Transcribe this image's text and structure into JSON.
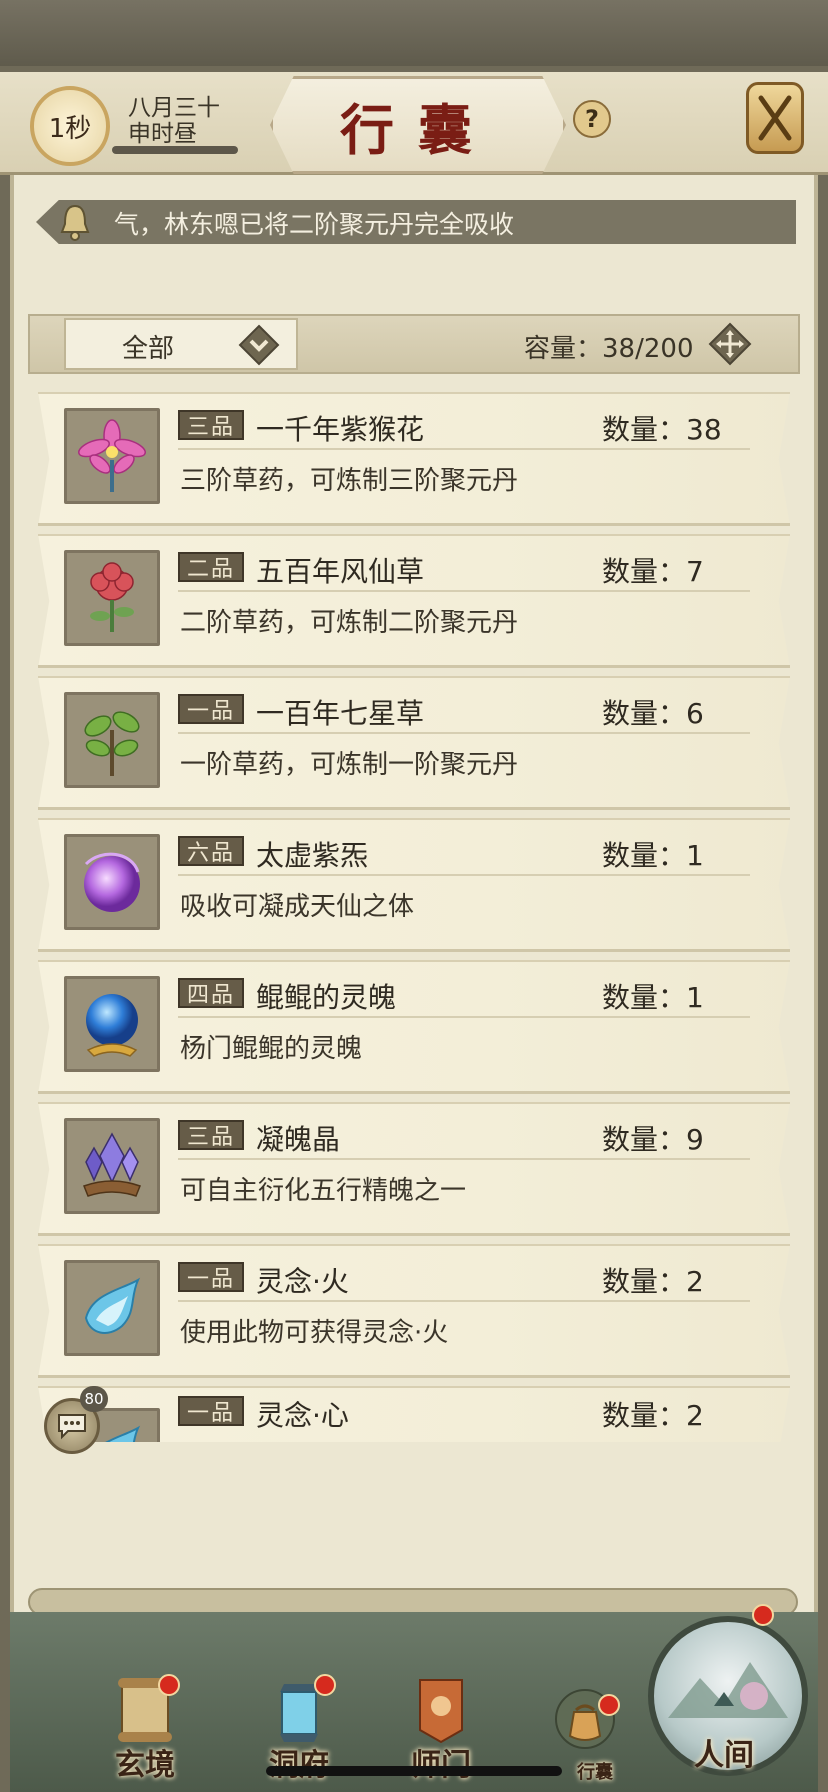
{
  "header": {
    "timer": "1秒",
    "date_line1": "八月三十",
    "date_line2": "申时昼",
    "title": "行囊",
    "help_label": "?"
  },
  "notice": {
    "text": "气，林东嗯已将二阶聚元丹完全吸收"
  },
  "filter": {
    "selected": "全部",
    "capacity_label": "容量：",
    "capacity_value": "38/200"
  },
  "items": [
    {
      "grade": "三品",
      "name": "一千年紫猴花",
      "qty_label": "数量：",
      "qty": "38",
      "desc": "三阶草药，可炼制三阶聚元丹",
      "icon": "purple-flower-icon"
    },
    {
      "grade": "二品",
      "name": "五百年风仙草",
      "qty_label": "数量：",
      "qty": "7",
      "desc": "二阶草药，可炼制二阶聚元丹",
      "icon": "red-flower-icon"
    },
    {
      "grade": "一品",
      "name": "一百年七星草",
      "qty_label": "数量：",
      "qty": "6",
      "desc": "一阶草药，可炼制一阶聚元丹",
      "icon": "green-herb-icon"
    },
    {
      "grade": "六品",
      "name": "太虚紫炁",
      "qty_label": "数量：",
      "qty": "1",
      "desc": "吸收可凝成天仙之体",
      "icon": "purple-orb-icon"
    },
    {
      "grade": "四品",
      "name": "鲲鲲的灵魄",
      "qty_label": "数量：",
      "qty": "1",
      "desc": "杨门鲲鲲的灵魄",
      "icon": "blue-orb-icon"
    },
    {
      "grade": "三品",
      "name": "凝魄晶",
      "qty_label": "数量：",
      "qty": "9",
      "desc": "可自主衍化五行精魄之一",
      "icon": "crystal-icon"
    },
    {
      "grade": "一品",
      "name": "灵念·火",
      "qty_label": "数量：",
      "qty": "2",
      "desc": "使用此物可获得灵念·火",
      "icon": "spirit-flame-icon"
    },
    {
      "grade": "一品",
      "name": "灵念·心",
      "qty_label": "数量：",
      "qty": "2",
      "desc": "",
      "icon": "spirit-heart-icon"
    }
  ],
  "chat": {
    "badge": "80"
  },
  "nav": {
    "items": [
      {
        "label": "玄境",
        "icon": "scroll-icon"
      },
      {
        "label": "洞府",
        "icon": "lantern-icon"
      },
      {
        "label": "师门",
        "icon": "banner-icon"
      },
      {
        "label": "行囊",
        "icon": "pouch-icon"
      },
      {
        "label": "人间",
        "icon": "world-icon"
      }
    ]
  },
  "colors": {
    "title_red": "#7a1d14",
    "badge_red": "#d62a1e",
    "parchment": "#ece7d2"
  }
}
